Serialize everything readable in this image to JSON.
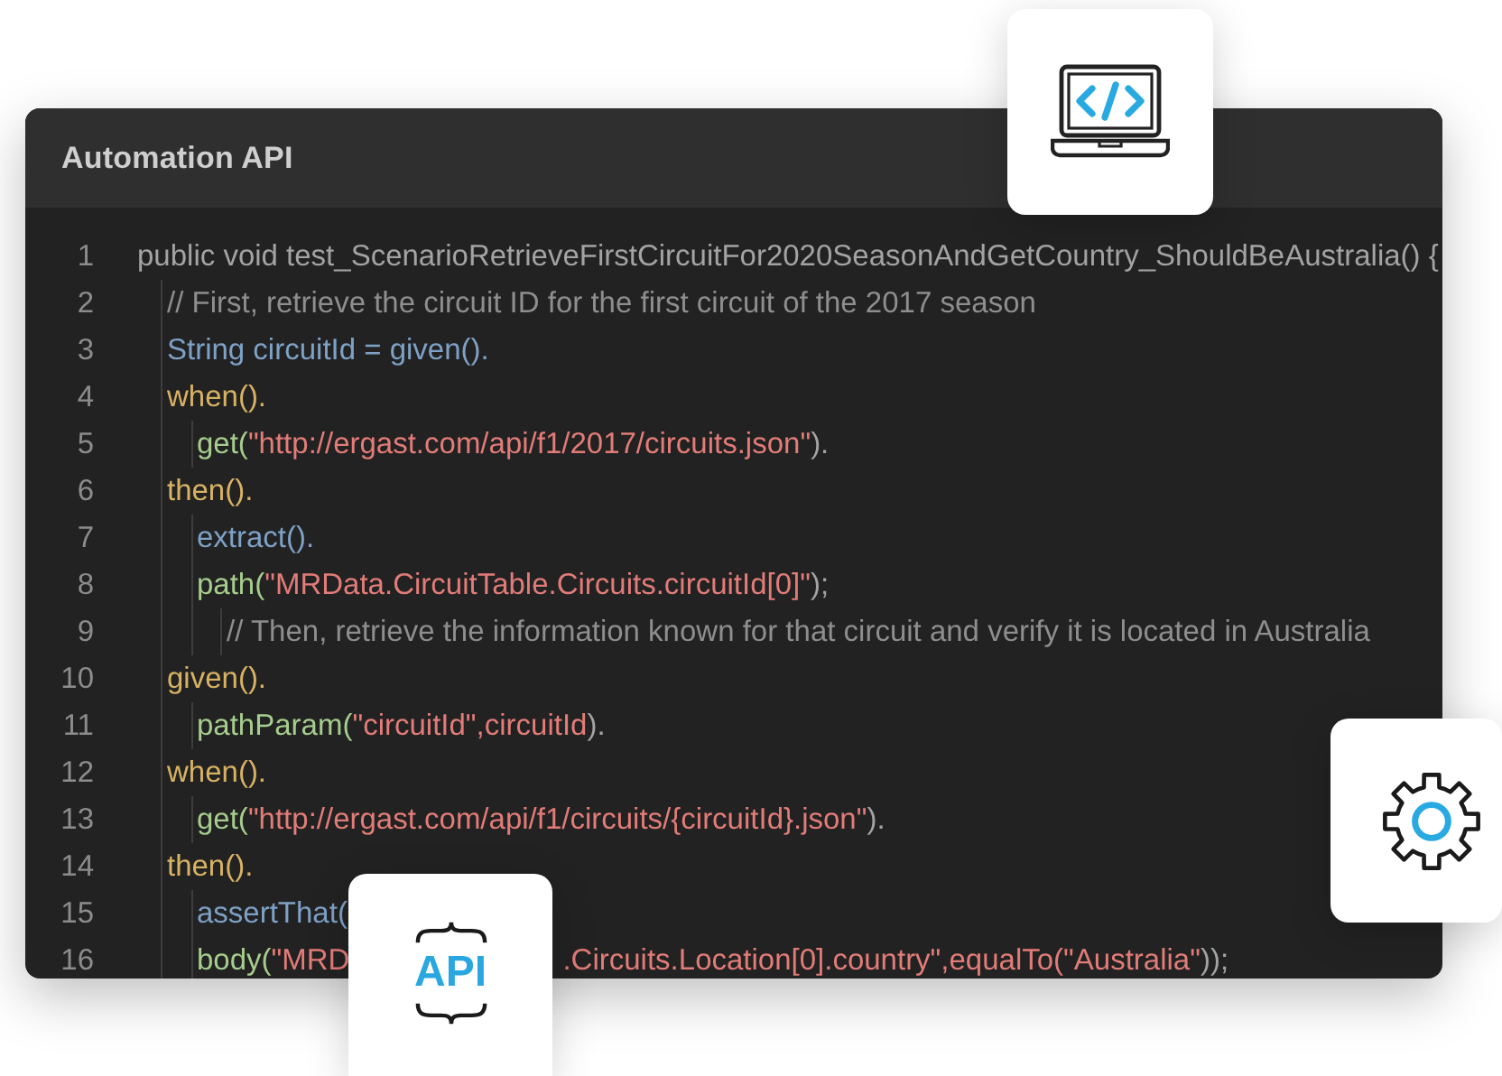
{
  "window": {
    "title": "Automation API"
  },
  "code": [
    {
      "num": "1",
      "parts": [
        [
          {
            "kind": "plain",
            "text": "public void test_ScenarioRetrieveFirstCircuitFor2020SeasonAndGetCountry_ShouldBeAustralia() {"
          }
        ]
      ],
      "children": [
        {
          "num": "2",
          "parts": [
            [
              {
                "kind": "comment",
                "text": "// First, retrieve the circuit ID for the first circuit of the 2017 season"
              }
            ]
          ]
        },
        {
          "num": "3",
          "parts": [
            [
              {
                "kind": "variable",
                "text": "String circuitId = given()."
              }
            ]
          ]
        },
        {
          "num": "4",
          "parts": [
            [
              {
                "kind": "keyword",
                "text": "when()."
              }
            ]
          ],
          "children": [
            {
              "num": "5",
              "parts": [
                [
                  {
                    "kind": "method",
                    "text": "get("
                  },
                  {
                    "kind": "string",
                    "text": "\"http://ergast.com/api/f1/2017/circuits.json\""
                  },
                  {
                    "kind": "plain",
                    "text": ")."
                  }
                ]
              ]
            }
          ]
        },
        {
          "num": "6",
          "parts": [
            [
              {
                "kind": "keyword",
                "text": "then()."
              }
            ]
          ],
          "children": [
            {
              "num": "7",
              "parts": [
                [
                  {
                    "kind": "variable",
                    "text": "extract()."
                  }
                ]
              ]
            },
            {
              "num": "8",
              "parts": [
                [
                  {
                    "kind": "method",
                    "text": "path("
                  },
                  {
                    "kind": "string",
                    "text": "\"MRData.CircuitTable.Circuits.circuitId[0]\""
                  },
                  {
                    "kind": "plain",
                    "text": ");"
                  }
                ]
              ],
              "children": [
                {
                  "num": "9",
                  "parts": [
                    [
                      {
                        "kind": "comment",
                        "text": "// Then, retrieve the information known for that circuit and verify it is located in Australia"
                      }
                    ]
                  ]
                }
              ]
            }
          ]
        },
        {
          "num": "10",
          "parts": [
            [
              {
                "kind": "keyword",
                "text": "given()."
              }
            ]
          ],
          "children": [
            {
              "num": "11",
              "parts": [
                [
                  {
                    "kind": "method",
                    "text": "pathParam("
                  },
                  {
                    "kind": "string",
                    "text": "\"circuitId\",circuitId"
                  },
                  {
                    "kind": "plain",
                    "text": ")."
                  }
                ]
              ]
            }
          ]
        },
        {
          "num": "12",
          "parts": [
            [
              {
                "kind": "keyword",
                "text": "when()."
              }
            ]
          ],
          "children": [
            {
              "num": "13",
              "parts": [
                [
                  {
                    "kind": "method",
                    "text": "get("
                  },
                  {
                    "kind": "string",
                    "text": "\"http://ergast.com/api/f1/circuits/{circuitId}.json\""
                  },
                  {
                    "kind": "plain",
                    "text": ")."
                  }
                ]
              ]
            }
          ]
        },
        {
          "num": "14",
          "parts": [
            [
              {
                "kind": "keyword",
                "text": "then()."
              }
            ]
          ],
          "children": [
            {
              "num": "15",
              "parts": [
                [
                  {
                    "kind": "variable",
                    "text": "assertThat("
                  }
                ]
              ]
            },
            {
              "num": "16",
              "parts": [
                [
                  {
                    "kind": "method",
                    "text": "body("
                  },
                  {
                    "kind": "string",
                    "text": "\"MRD"
                  }
                ],
                [
                  {
                    "kind": "string",
                    "text": ".Circuits.Location[0].country\",equalTo(\"Australia\""
                  },
                  {
                    "kind": "plain",
                    "text": "));"
                  }
                ]
              ]
            }
          ]
        }
      ]
    }
  ],
  "badges": [
    {
      "kind": "code"
    },
    {
      "kind": "gear"
    },
    {
      "kind": "api",
      "text": "API"
    }
  ]
}
